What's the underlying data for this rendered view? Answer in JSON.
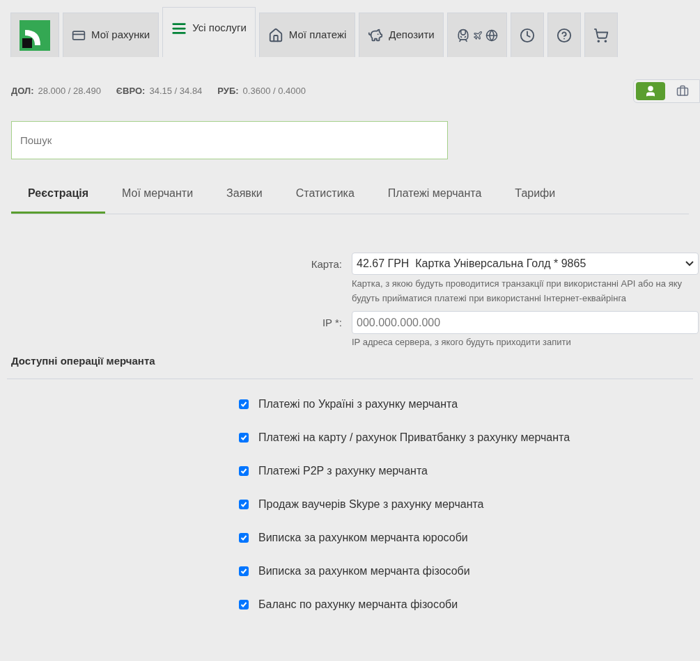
{
  "nav_tabs": [
    {
      "kind": "logo",
      "selected": false
    },
    {
      "kind": "text",
      "label": "Мої рахунки",
      "selected": false
    },
    {
      "kind": "text",
      "label": "Усі послуги",
      "selected": true
    },
    {
      "kind": "text",
      "label": "Мої платежі",
      "selected": false
    },
    {
      "kind": "text",
      "label": "Депозити",
      "selected": false
    },
    {
      "kind": "icon",
      "selected": false
    },
    {
      "kind": "icon",
      "selected": false
    },
    {
      "kind": "icon",
      "selected": false
    },
    {
      "kind": "icon",
      "selected": false
    }
  ],
  "rates": [
    {
      "code": "ДОЛ:",
      "value": "28.000 / 28.490"
    },
    {
      "code": "ЄВРО:",
      "value": "34.15 / 34.84"
    },
    {
      "code": "РУБ:",
      "value": "0.3600 / 0.4000"
    }
  ],
  "profile_toggle": [
    {
      "kind": "person",
      "selected": true
    },
    {
      "kind": "business",
      "selected": false
    }
  ],
  "search": {
    "placeholder": "Пошук"
  },
  "tabs": [
    {
      "label": "Реєстрація",
      "selected": true
    },
    {
      "label": "Мої мерчанти",
      "selected": false
    },
    {
      "label": "Заявки",
      "selected": false
    },
    {
      "label": "Статистика",
      "selected": false
    },
    {
      "label": "Платежі мерчанта",
      "selected": false
    },
    {
      "label": "Тарифи",
      "selected": false
    }
  ],
  "form": {
    "card": {
      "label": "Карта:",
      "value": "42.67 ГРН  Картка Універсальна Голд * 9865",
      "hint": "Картка, з якою будуть проводитися транзакції при використанні API або на яку будуть прийматися платежі при використанні Інтернет-еквайрінга"
    },
    "ip": {
      "label": "IP *:",
      "placeholder": "000.000.000.000",
      "hint": "IP адреса сервера, з якого будуть приходити запити"
    }
  },
  "operations": {
    "title": "Доступні операції мерчанта",
    "items": [
      {
        "label": "Платежі по Україні з рахунку мерчанта",
        "checked": true
      },
      {
        "label": "Платежі на карту / рахунок Приватбанку з рахунку мерчанта",
        "checked": true
      },
      {
        "label": "Платежі P2P з рахунку мерчанта",
        "checked": true
      },
      {
        "label": "Продаж ваучерів Skype з рахунку мерчанта",
        "checked": true
      },
      {
        "label": "Виписка за рахунком мерчанта юрособи",
        "checked": true
      },
      {
        "label": "Виписка за рахунком мерчанта фізособи",
        "checked": true
      },
      {
        "label": "Баланс по рахунку мерчанта фізособи",
        "checked": true
      }
    ]
  }
}
